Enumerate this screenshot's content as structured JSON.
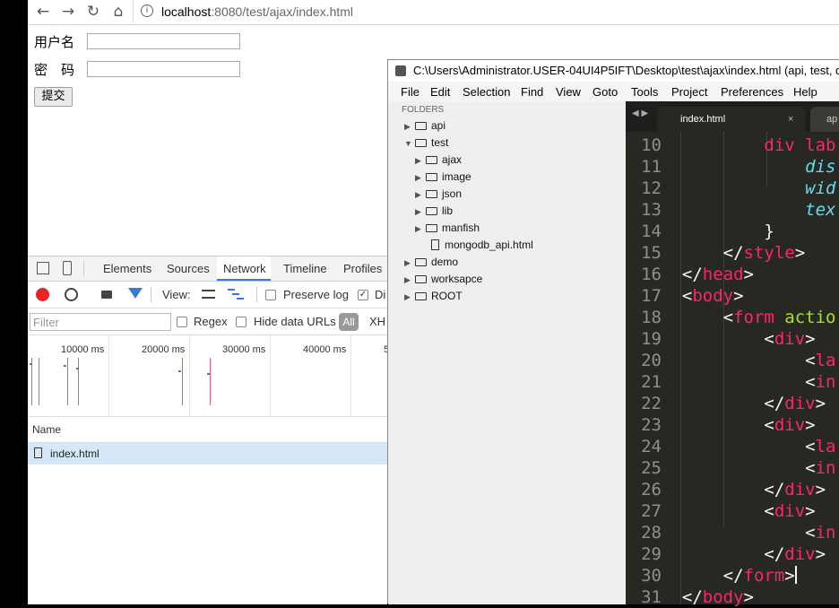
{
  "browser": {
    "url_host": "localhost",
    "url_path": ":8080/test/ajax/index.html",
    "info_glyph": "i"
  },
  "page": {
    "username_label": "用户名",
    "password_label": "密　码",
    "submit_label": "提交"
  },
  "devtools": {
    "tabs": [
      "Elements",
      "Sources",
      "Network",
      "Timeline",
      "Profiles"
    ],
    "active_tab": "Network",
    "view_label": "View:",
    "preserve_log": "Preserve log",
    "disable_cache_partial": "Di",
    "filter_placeholder": "Filter",
    "regex_label": "Regex",
    "hide_data_urls": "Hide data URLs",
    "all_label": "All",
    "xhr_partial": "XH",
    "timeline_labels": [
      "10000 ms",
      "20000 ms",
      "30000 ms",
      "40000 ms",
      "5"
    ],
    "name_header": "Name",
    "rows": [
      {
        "name": "index.html"
      }
    ]
  },
  "sublime": {
    "title": "C:\\Users\\Administrator.USER-04UI4P5IFT\\Desktop\\test\\ajax\\index.html (api, test, d",
    "menu": [
      "File",
      "Edit",
      "Selection",
      "Find",
      "View",
      "Goto",
      "Tools",
      "Project",
      "Preferences",
      "Help"
    ],
    "folders_label": "FOLDERS",
    "tree": {
      "api": "api",
      "test": "test",
      "ajax": "ajax",
      "image": "image",
      "json": "json",
      "lib": "lib",
      "manfish": "manfish",
      "mongodb": "mongodb_api.html",
      "demo": "demo",
      "worksapce": "worksapce",
      "root": "ROOT"
    },
    "tab_active": "index.html",
    "tab_close": "×",
    "tab_second": "ap",
    "tab_nav": "◀ ▶",
    "lines": {
      "n10": "10",
      "n11": "11",
      "n12": "12",
      "n13": "13",
      "n14": "14",
      "n15": "15",
      "n16": "16",
      "n17": "17",
      "n18": "18",
      "n19": "19",
      "n20": "20",
      "n21": "21",
      "n22": "22",
      "n23": "23",
      "n24": "24",
      "n25": "25",
      "n26": "26",
      "n27": "27",
      "n28": "28",
      "n29": "29",
      "n30": "30",
      "n31": "31",
      "l10a": "div",
      "l10b": " lab",
      "l11": "dis",
      "l12": "wid",
      "l13": "tex",
      "l14": "}",
      "l15a": "</",
      "l15b": "style",
      "l15c": ">",
      "l16a": "</",
      "l16b": "head",
      "l16c": ">",
      "l17a": "<",
      "l17b": "body",
      "l17c": ">",
      "l18a": "<",
      "l18b": "form",
      "l18c": " actio",
      "l19a": "<",
      "l19b": "div",
      "l19c": ">",
      "l20a": "<",
      "l20b": "la",
      "l21a": "<",
      "l21b": "in",
      "l22a": "</",
      "l22b": "div",
      "l22c": ">",
      "l23a": "<",
      "l23b": "div",
      "l23c": ">",
      "l24a": "<",
      "l24b": "la",
      "l25a": "<",
      "l25b": "in",
      "l26a": "</",
      "l26b": "div",
      "l26c": ">",
      "l27a": "<",
      "l27b": "div",
      "l27c": ">",
      "l28a": "<",
      "l28b": "in",
      "l29a": "</",
      "l29b": "div",
      "l29c": ">",
      "l30a": "</",
      "l30b": "form",
      "l30c": ">",
      "l31a": "</",
      "l31b": "body",
      "l31c": ">"
    }
  }
}
